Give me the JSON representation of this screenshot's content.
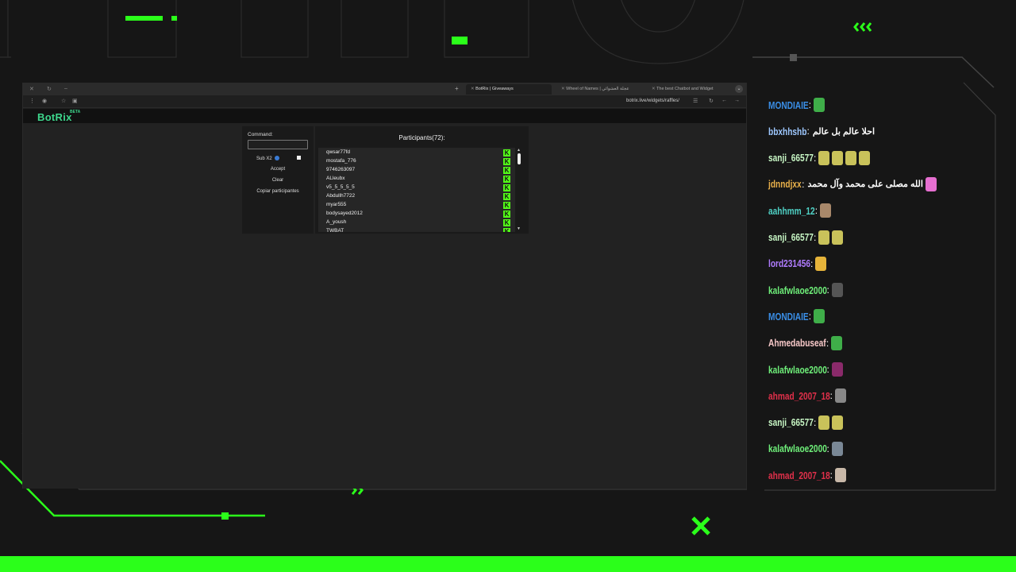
{
  "browser": {
    "tabs": [
      {
        "label": "BotRix | Giveaways",
        "active": true
      },
      {
        "label": "Wheel of Names | عجلة العشوائي",
        "active": false
      },
      {
        "label": "The best Chatbot and Widget",
        "active": false
      }
    ],
    "url": "botrix.live/widgets/raffles/"
  },
  "app": {
    "brand": "BotRix",
    "beta": "BETA"
  },
  "giveaway": {
    "command_label": "Command:",
    "command_value": "",
    "sub_label": "Sub X2",
    "accept_label": "Accept",
    "clear_label": "Clear",
    "copy_label": "Copiar participantes",
    "participants_title": "Participants(72):",
    "participants": [
      "qwsar77fd",
      "mostafa_776",
      "9746263097",
      "ALleubx",
      "v5_5_5_5_5",
      "Abdullh7722",
      "myar555",
      "bodysayed2012",
      "A_yoush",
      "TWBAT"
    ],
    "kick_icon": "kick-logo-icon"
  },
  "chat": {
    "messages": [
      {
        "user": "MONDIAIE",
        "color": "#3a8ee6",
        "text": "",
        "emote": "#3fae49"
      },
      {
        "user": "bbxhhshb",
        "color": "#9ec8ff",
        "text": "احلا عالم بل عالم",
        "emote": ""
      },
      {
        "user": "sanji_66577",
        "color": "#c8f7c5",
        "text": "",
        "emote": "#c9c25a",
        "count": 4
      },
      {
        "user": "jdnndjxx",
        "color": "#e8b04a",
        "text": "الله مصلى على محمد وآل محمد",
        "emote": "#e66fd0"
      },
      {
        "user": "aahhmm_12",
        "color": "#4fd1c5",
        "text": "",
        "emote": "#a8886a"
      },
      {
        "user": "sanji_66577",
        "color": "#c8f7c5",
        "text": "",
        "emote": "#c9c25a",
        "count": 2
      },
      {
        "user": "lord231456",
        "color": "#b07cff",
        "text": "",
        "emote": "#e6b43a"
      },
      {
        "user": "kalafwlaoe2000",
        "color": "#6ff07a",
        "text": "",
        "emote": "#555"
      },
      {
        "user": "MONDIAIE",
        "color": "#3a8ee6",
        "text": "",
        "emote": "#3fae49"
      },
      {
        "user": "Ahmedabuseaf",
        "color": "#f7c8c8",
        "text": "",
        "emote": "#3fae49"
      },
      {
        "user": "kalafwlaoe2000",
        "color": "#6ff07a",
        "text": "",
        "emote": "#8a2a6a"
      },
      {
        "user": "ahmad_2007_18",
        "color": "#e0304a",
        "text": "",
        "emote": "#888"
      },
      {
        "user": "sanji_66577",
        "color": "#c8f7c5",
        "text": "",
        "emote": "#c9c25a",
        "count": 2
      },
      {
        "user": "kalafwlaoe2000",
        "color": "#6ff07a",
        "text": "",
        "emote": "#7a8896"
      },
      {
        "user": "ahmad_2007_18",
        "color": "#e0304a",
        "text": "",
        "emote": "#c8b8a8"
      }
    ]
  },
  "colors": {
    "accent": "#2bff1a",
    "brand": "#3dd68c",
    "kick": "#53fc18"
  }
}
